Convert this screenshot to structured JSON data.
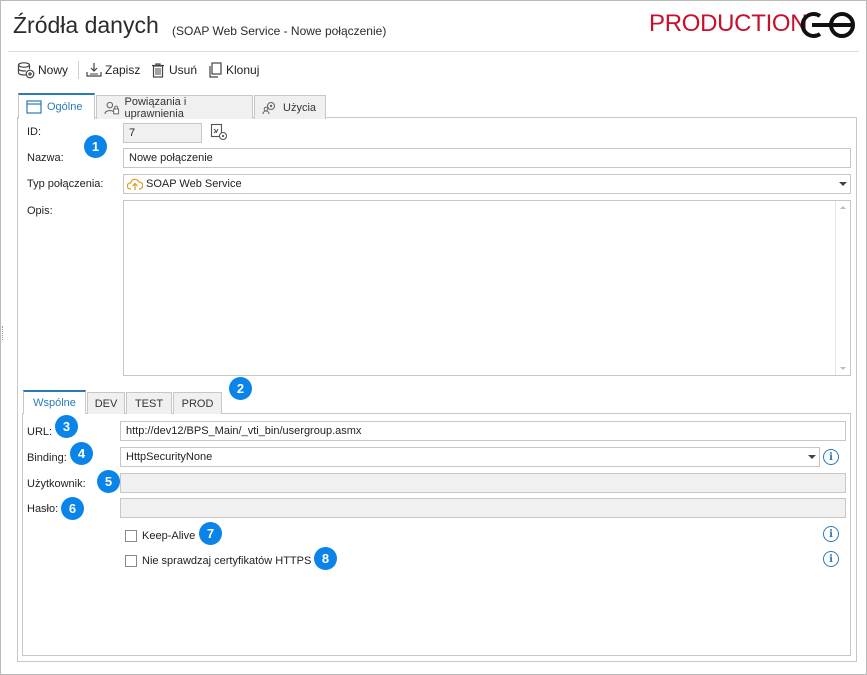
{
  "header": {
    "title": "Źródła danych",
    "subtitle": "(SOAP Web Service - Nowe połączenie)",
    "environment_label": "PRODUCTION"
  },
  "toolbar": {
    "new_label": "Nowy",
    "save_label": "Zapisz",
    "delete_label": "Usuń",
    "clone_label": "Klonuj"
  },
  "tabs": {
    "general": "Ogólne",
    "relations": "Powiązania i uprawnienia",
    "usages": "Użycia"
  },
  "general": {
    "id_label": "ID:",
    "id_value": "7",
    "name_label": "Nazwa:",
    "name_value": "Nowe połączenie",
    "type_label": "Typ połączenia:",
    "type_value": "SOAP Web Service",
    "desc_label": "Opis:"
  },
  "subtabs": {
    "common": "Wspólne",
    "dev": "DEV",
    "test": "TEST",
    "prod": "PROD"
  },
  "common": {
    "url_label": "URL:",
    "url_value": "http://dev12/BPS_Main/_vti_bin/usergroup.asmx",
    "binding_label": "Binding:",
    "binding_value": "HttpSecurityNone",
    "user_label": "Użytkownik:",
    "password_label": "Hasło:",
    "keepalive_label": "Keep-Alive",
    "nocert_label": "Nie sprawdzaj certyfikatów HTTPS"
  },
  "badges": [
    "1",
    "2",
    "3",
    "4",
    "5",
    "6",
    "7",
    "8"
  ],
  "colors": {
    "accent": "#2a7ab8",
    "production": "#c8102e",
    "badge": "#0a84e8"
  },
  "icons": [
    "new-database-icon",
    "save-icon",
    "delete-icon",
    "clone-icon",
    "window-icon",
    "user-lock-icon",
    "gear-users-icon",
    "id-settings-icon",
    "cloud-upload-icon",
    "info-icon"
  ]
}
